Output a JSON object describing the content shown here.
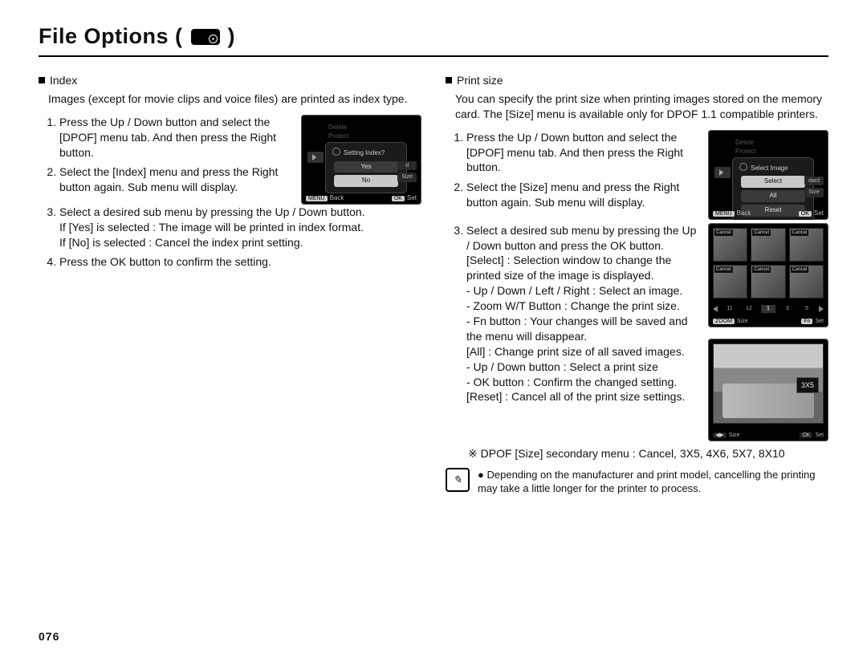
{
  "title": "File Options (",
  "title_close": ")",
  "page_number": "076",
  "left": {
    "heading": "Index",
    "intro": "Images (except for movie clips and voice files) are printed as index type.",
    "step1": "Press the Up / Down button and select the [DPOF] menu tab. And then press the Right button.",
    "step2": "Select the [Index] menu and press the Right button again. Sub menu will display.",
    "step3_lead": "Select a desired sub menu by pressing the Up / Down button.",
    "step3_yes": "If [Yes] is selected  : The image will be printed in index format.",
    "step3_no": "If [No] is selected   : Cancel the index print setting.",
    "step4": "Press the OK button to confirm the setting.",
    "screen": {
      "faded1": "Delete",
      "faded2": "Protect",
      "panel_title": "Setting Index?",
      "opt_yes": "Yes",
      "opt_no": "No",
      "tab_standard": "d",
      "tab_size": "Size",
      "back_btn": "MENU",
      "back_label": "Back",
      "ok_btn": "OK",
      "set_label": "Set"
    }
  },
  "right": {
    "heading": "Print size",
    "intro": "You can specify the print size when printing images stored on the memory card. The [Size] menu is available only for DPOF 1.1 compatible printers.",
    "step1": "Press the Up / Down button and select the [DPOF] menu tab. And then press the Right button.",
    "step2": "Select the [Size] menu and press the Right button again. Sub menu will display.",
    "step3_lead": "Select a desired sub menu by pressing the Up / Down button and press the OK button.",
    "select_label": "[Select] : Selection window to change the printed size of the image is displayed.",
    "sel_b1": "- Up / Down / Left / Right : Select an image.",
    "sel_b2": "- Zoom W/T Button : Change the print size.",
    "sel_b3": "- Fn button : Your changes will be saved and the menu will disappear.",
    "all_label": "[All] : Change print size of all saved images.",
    "all_b1": "- Up / Down button : Select a print size",
    "all_b2": "- OK button : Confirm the changed setting.",
    "reset_label": "[Reset] : Cancel all of the print size settings.",
    "secondary_lead": "※ DPOF [Size] secondary menu : Cancel, 3X5, 4X6, 5X7, 8X10",
    "note_bullet": "●",
    "note": "Depending on the manufacturer and print model, cancelling the printing may take a little longer for the printer to process.",
    "screen1": {
      "faded1": "Delete",
      "faded2": "Protect",
      "panel_title": "Select Image",
      "opt_select": "Select",
      "opt_all": "All",
      "opt_reset": "Reset",
      "tab_standard": "dard",
      "tab_size": "Size",
      "back_btn": "MENU",
      "back_label": "Back",
      "ok_btn": "OK",
      "set_label": "Set"
    },
    "screen2": {
      "tag": "Cancel",
      "pager": [
        "11",
        "12",
        "1",
        "3",
        "5"
      ],
      "btn_left": "ZOOM",
      "label_left": "Size",
      "btn_right": "Fn",
      "label_right": "Set"
    },
    "screen3": {
      "badge": "3X5",
      "btn_left": "◀▶",
      "label_left": "Size",
      "btn_right": "OK",
      "label_right": "Set"
    }
  }
}
